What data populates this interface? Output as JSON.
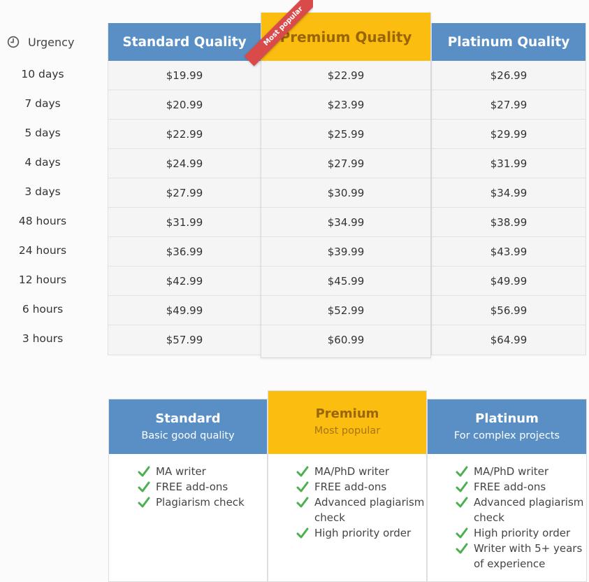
{
  "urgency": {
    "label": "Urgency",
    "items": [
      "10 days",
      "7 days",
      "5 days",
      "4 days",
      "3 days",
      "48 hours",
      "24 hours",
      "12 hours",
      "6 hours",
      "3 hours"
    ]
  },
  "ribbon": {
    "label": "Most popular"
  },
  "price_table": {
    "standard": {
      "title": "Standard Quality",
      "prices": [
        "$19.99",
        "$20.99",
        "$22.99",
        "$24.99",
        "$27.99",
        "$31.99",
        "$36.99",
        "$42.99",
        "$49.99",
        "$57.99"
      ]
    },
    "premium": {
      "title": "Premium Quality",
      "prices": [
        "$22.99",
        "$23.99",
        "$25.99",
        "$27.99",
        "$30.99",
        "$34.99",
        "$39.99",
        "$45.99",
        "$52.99",
        "$60.99"
      ]
    },
    "platinum": {
      "title": "Platinum Quality",
      "prices": [
        "$26.99",
        "$27.99",
        "$29.99",
        "$31.99",
        "$34.99",
        "$38.99",
        "$43.99",
        "$49.99",
        "$56.99",
        "$64.99"
      ]
    }
  },
  "plans": {
    "standard": {
      "title": "Standard",
      "subtitle": "Basic good quality",
      "features": [
        "MA writer",
        "FREE add-ons",
        "Plagiarism check"
      ]
    },
    "premium": {
      "title": "Premium",
      "subtitle": "Most popular",
      "features": [
        "MA/PhD writer",
        "FREE add-ons",
        "Advanced plagiarism check",
        "High priority order"
      ]
    },
    "platinum": {
      "title": "Platinum",
      "subtitle": "For complex projects",
      "features": [
        "MA/PhD writer",
        "FREE add-ons",
        "Advanced plagiarism check",
        "High priority order",
        "Writer with 5+ years of experience"
      ]
    }
  },
  "colors": {
    "blue": "#5a8fc6",
    "gold": "#fbbd0f",
    "gold_text": "#9a6506",
    "ribbon": "#d94b4b",
    "check": "#4caf50"
  },
  "icons": {
    "urgency": "clock-icon",
    "feature": "checkmark-icon"
  }
}
